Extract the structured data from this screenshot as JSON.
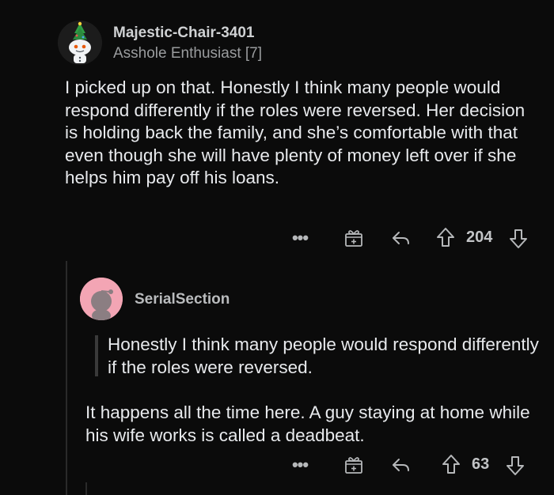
{
  "comment": {
    "username": "Majestic-Chair-3401",
    "flair": "Asshole Enthusiast [7]",
    "body": "I picked up on that. Honestly I think many people would respond differently if the roles were reversed. Her decision is holding back the family, and she’s comfortable with that even though she will have plenty of money left over if she helps him pay off his loans.",
    "more_label": "•••",
    "vote_count": "204",
    "icons": {
      "avatar": "snoo-christmas-tree-avatar-icon",
      "award": "award-gift-icon",
      "reply": "reply-arrow-icon",
      "upvote": "upvote-arrow-icon",
      "downvote": "downvote-arrow-icon"
    }
  },
  "reply": {
    "username": "SerialSection",
    "quote": "Honestly I think many people would respond differently if the roles were reversed.",
    "body": "It happens all the time here.  A guy staying at home while his wife works is called a deadbeat.",
    "more_label": "•••",
    "vote_count": "63",
    "avatar_color": "#f3a5b4"
  }
}
